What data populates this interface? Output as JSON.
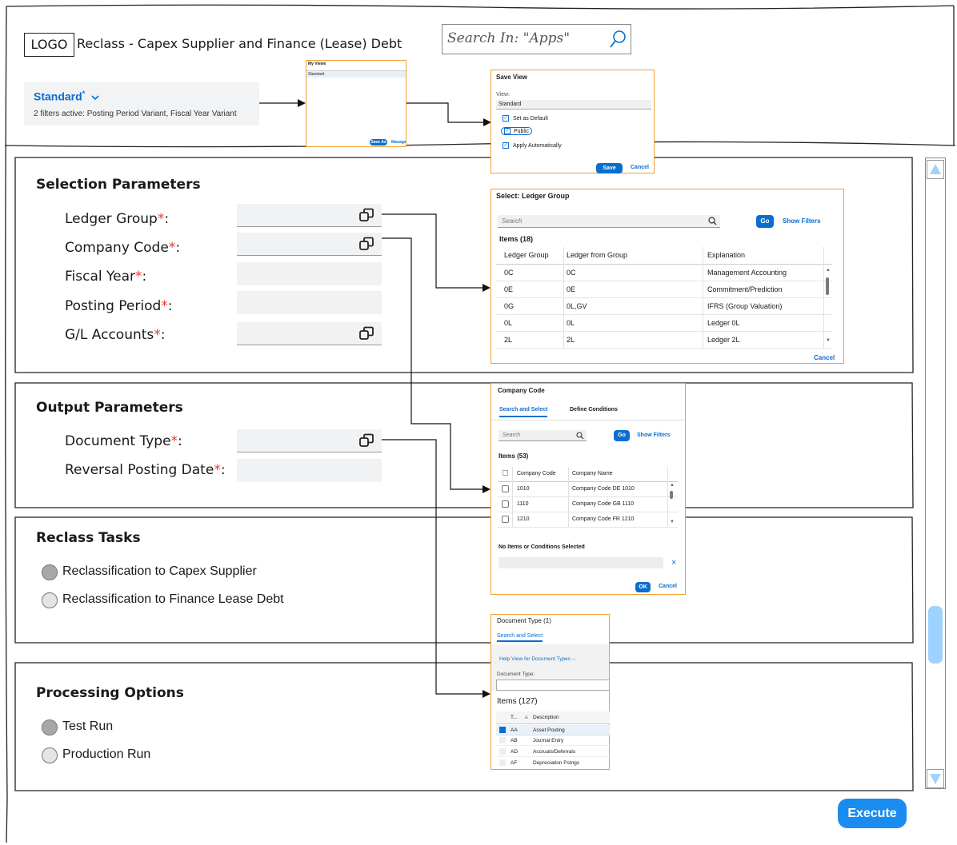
{
  "header": {
    "logo": "LOGO",
    "title": "Reclass - Capex Supplier and Finance (Lease) Debt",
    "search_placeholder": "Search In: \"Apps\""
  },
  "variant": {
    "name": "Standard",
    "modified_marker": "*",
    "filters_text": "2 filters active: Posting Period Variant, Fiscal Year Variant"
  },
  "my_views_popup": {
    "title": "My Views",
    "item": "Standard",
    "save_as": "Save As",
    "manage": "Manage"
  },
  "save_view_popup": {
    "title": "Save View",
    "view_label": "View:",
    "view_value": "Standard",
    "set_default": "Set as Default",
    "public": "Public",
    "apply_auto": "Apply Automatically",
    "save": "Save",
    "cancel": "Cancel"
  },
  "selection": {
    "title": "Selection Parameters",
    "fields": [
      {
        "label": "Ledger Group",
        "req": "*",
        "colon": ":"
      },
      {
        "label": "Company Code",
        "req": "*",
        "colon": ":"
      },
      {
        "label": "Fiscal Year",
        "req": "*",
        "colon": ":"
      },
      {
        "label": "Posting Period",
        "req": "*",
        "colon": ":"
      },
      {
        "label": "G/L Accounts",
        "req": "*",
        "colon": ":"
      }
    ]
  },
  "ledger_popup": {
    "title": "Select: Ledger Group",
    "search_placeholder": "Search",
    "go": "Go",
    "show_filters": "Show Filters",
    "items_count": "Items (18)",
    "columns": [
      "Ledger Group",
      "Ledger from Group",
      "Explanation"
    ],
    "rows": [
      [
        "0C",
        "0C",
        "Management Accounting"
      ],
      [
        "0E",
        "0E",
        "Commitment/Prediction"
      ],
      [
        "0G",
        "0L,GV",
        "IFRS (Group Valuation)"
      ],
      [
        "0L",
        "0L",
        "Ledger 0L"
      ],
      [
        "2L",
        "2L",
        "Ledger 2L"
      ]
    ],
    "cancel": "Cancel"
  },
  "output": {
    "title": "Output Parameters",
    "fields": [
      {
        "label": "Document Type",
        "req": "*",
        "colon": ":"
      },
      {
        "label": "Reversal Posting Date",
        "req": "*",
        "colon": ":"
      }
    ]
  },
  "company_popup": {
    "title": "Company Code",
    "tabs": [
      "Search and Select",
      "Define Conditions"
    ],
    "search_placeholder": "Search",
    "go": "Go",
    "show_filters": "Show Filters",
    "items_count": "Items (53)",
    "columns": [
      "Company Code",
      "Company Name"
    ],
    "rows": [
      [
        "1010",
        "Company Code DE 1010"
      ],
      [
        "1110",
        "Company Code GB 1110"
      ],
      [
        "1210",
        "Company Code FR 1210"
      ]
    ],
    "none_selected": "No Items or Conditions Selected",
    "clear": "×",
    "ok": "OK",
    "cancel": "Cancel"
  },
  "reclass": {
    "title": "Reclass Tasks",
    "options": [
      "Reclassification to Capex Supplier",
      "Reclassification to Finance Lease Debt"
    ]
  },
  "doctype_popup": {
    "title": "Document Type (1)",
    "tab": "Search and Select",
    "help_view": "Help View for Document Types",
    "field_label": "Document Type:",
    "items_count": "Items (127)",
    "col_t": "T...",
    "col_sort": "≙",
    "col_desc": "Description",
    "rows": [
      [
        "AA",
        "Asset Posting"
      ],
      [
        "AB",
        "Journal Entry"
      ],
      [
        "AD",
        "Accruals/Deferrals"
      ],
      [
        "AF",
        "Depreciation Pstngs"
      ]
    ]
  },
  "processing": {
    "title": "Processing Options",
    "options": [
      "Test Run",
      "Production Run"
    ]
  },
  "execute": "Execute"
}
